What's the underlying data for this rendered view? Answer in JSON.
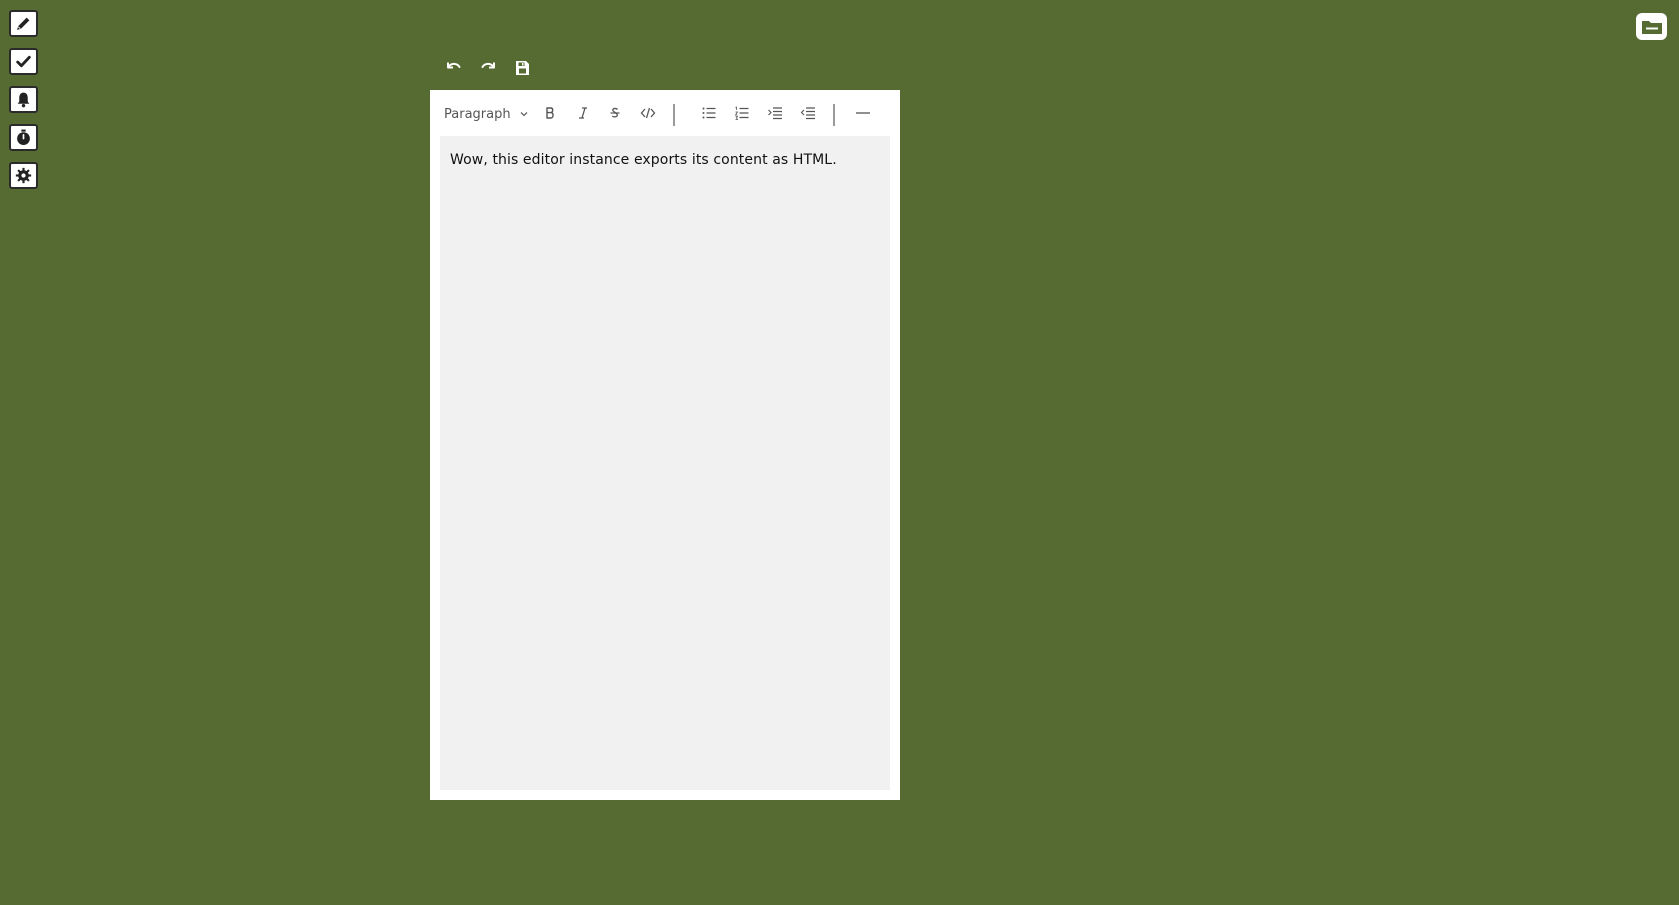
{
  "app": {
    "background_color": "#566b31"
  },
  "left_rail": {
    "items": [
      {
        "icon": "pencil-icon"
      },
      {
        "icon": "check-icon"
      },
      {
        "icon": "bell-icon"
      },
      {
        "icon": "stopwatch-icon"
      },
      {
        "icon": "gear-icon"
      }
    ]
  },
  "corner": {
    "icon": "folder-minus-icon"
  },
  "history": {
    "undo_icon": "undo-icon",
    "redo_icon": "redo-icon",
    "save_icon": "save-icon"
  },
  "toolbar": {
    "block_type": "Paragraph",
    "buttons": [
      {
        "name": "bold",
        "icon": "bold-icon"
      },
      {
        "name": "italic",
        "icon": "italic-icon"
      },
      {
        "name": "strikethrough",
        "icon": "strikethrough-icon"
      },
      {
        "name": "code",
        "icon": "code-icon"
      },
      {
        "name": "bullet-list",
        "icon": "bullet-list-icon"
      },
      {
        "name": "ordered-list",
        "icon": "ordered-list-icon"
      },
      {
        "name": "indent",
        "icon": "indent-icon"
      },
      {
        "name": "outdent",
        "icon": "outdent-icon"
      },
      {
        "name": "horizontal-rule",
        "icon": "horizontal-rule-icon"
      }
    ]
  },
  "editor": {
    "content": "Wow, this editor instance exports its content as HTML.",
    "surface_color": "#f1f1f1"
  }
}
